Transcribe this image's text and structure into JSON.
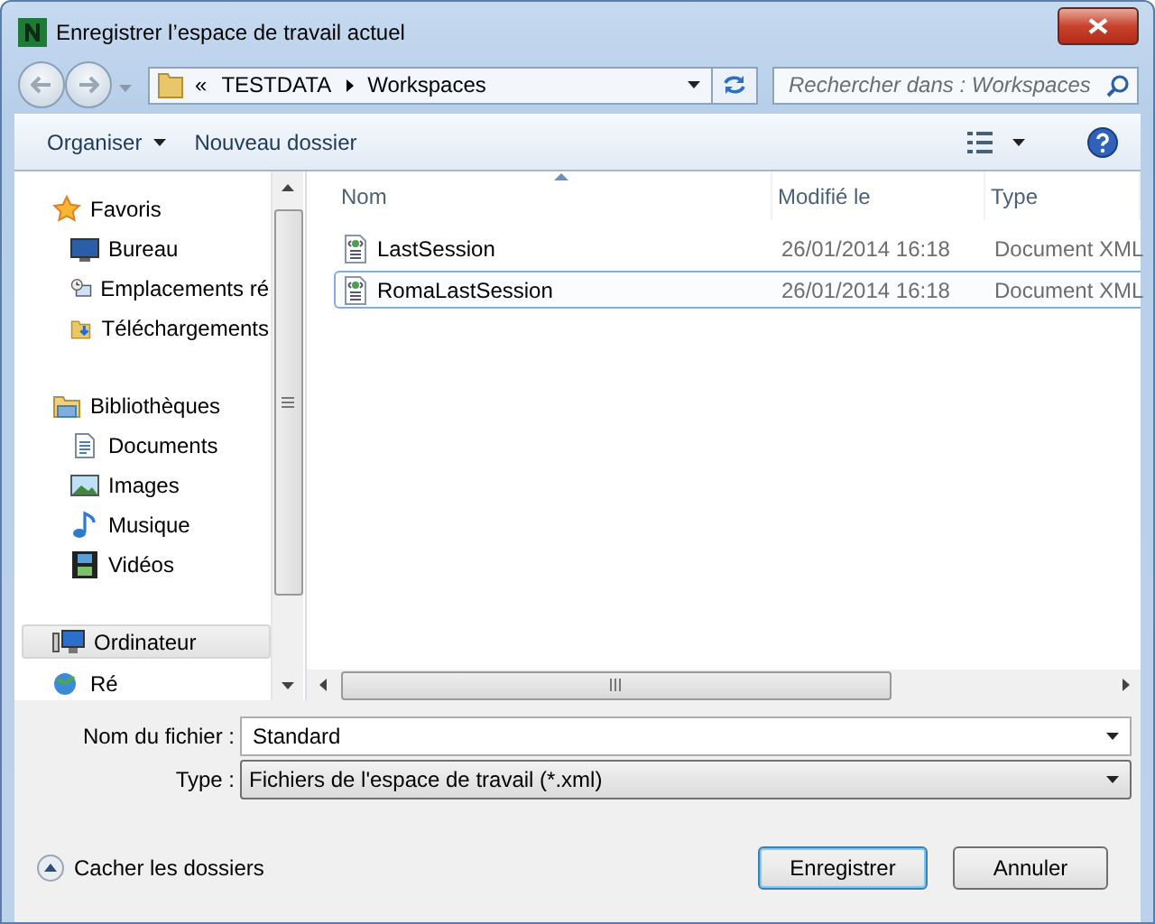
{
  "window": {
    "title": "Enregistrer l’espace de travail actuel"
  },
  "address": {
    "overflow": "«",
    "breadcrumb": [
      "TESTDATA",
      "Workspaces"
    ]
  },
  "search": {
    "placeholder": "Rechercher dans : Workspaces"
  },
  "toolbar": {
    "organize": "Organiser",
    "new_folder": "Nouveau dossier"
  },
  "sidebar": {
    "groups": [
      {
        "label": "Favoris",
        "selected": false,
        "children": [
          {
            "label": "Bureau",
            "selected": false
          },
          {
            "label": "Emplacements ré",
            "selected": false
          },
          {
            "label": "Téléchargements",
            "selected": false
          }
        ]
      },
      {
        "label": "Bibliothèques",
        "selected": false,
        "children": [
          {
            "label": "Documents",
            "selected": false
          },
          {
            "label": "Images",
            "selected": false
          },
          {
            "label": "Musique",
            "selected": false
          },
          {
            "label": "Vidéos",
            "selected": false
          }
        ]
      },
      {
        "label": "Ordinateur",
        "selected": true
      },
      {
        "label": "Ré",
        "selected": false
      }
    ]
  },
  "table": {
    "columns": [
      {
        "label": "Nom",
        "sorted": true
      },
      {
        "label": "Modifié le",
        "sorted": false
      },
      {
        "label": "Type",
        "sorted": false
      }
    ],
    "rows": [
      {
        "name": "LastSession",
        "modified": "26/01/2014 16:18",
        "type": "Document XML",
        "selected": false
      },
      {
        "name": "RomaLastSession",
        "modified": "26/01/2014 16:18",
        "type": "Document XML",
        "selected": true
      }
    ]
  },
  "form": {
    "filename": {
      "label": "Nom du fichier :",
      "value": "Standard"
    },
    "type": {
      "label": "Type :",
      "value": "Fichiers de l'espace de travail (*.xml)"
    }
  },
  "hide_folders": "Cacher les dossiers",
  "buttons": [
    {
      "label": "Enregistrer",
      "default": true
    },
    {
      "label": "Annuler",
      "default": false
    }
  ]
}
